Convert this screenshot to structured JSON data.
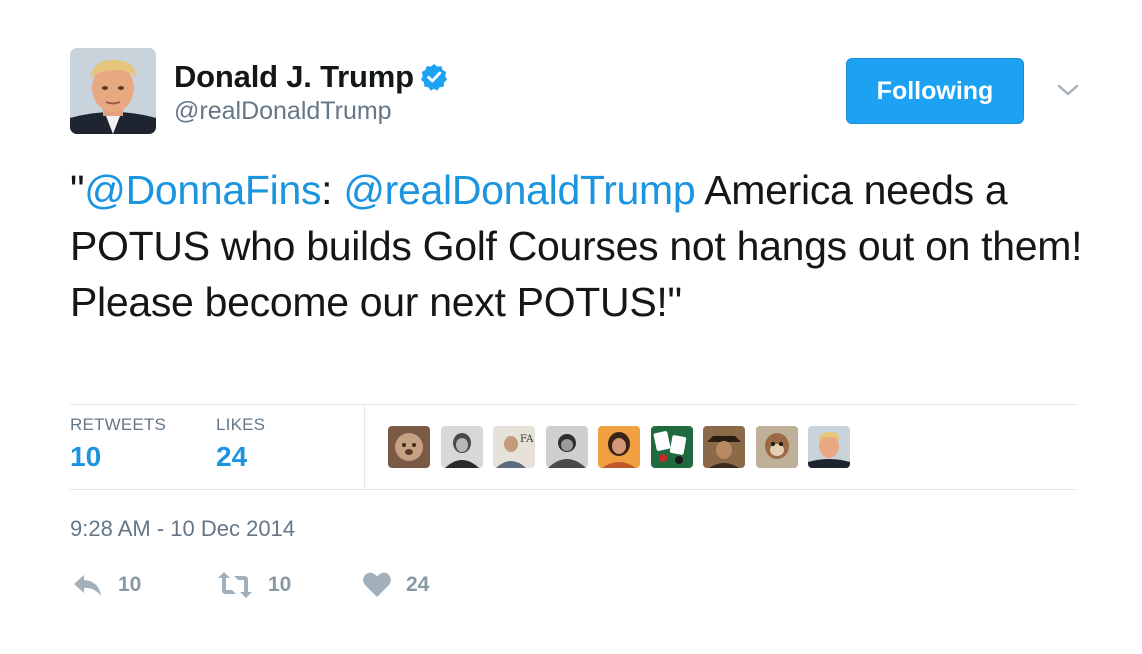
{
  "header": {
    "display_name": "Donald J. Trump",
    "handle": "@realDonaldTrump",
    "verified_icon": "verified-badge-icon",
    "follow_label": "Following",
    "menu_icon": "chevron-down-icon"
  },
  "tweet": {
    "quote_open": "\"",
    "mention_1": "@DonnaFins",
    "colon": ": ",
    "mention_2": "@realDonaldTrump",
    "body": " America needs a POTUS who builds Golf Courses not hangs out on them! Please become our next POTUS!\""
  },
  "stats": {
    "retweets_label": "RETWEETS",
    "retweets_value": "10",
    "likes_label": "LIKES",
    "likes_value": "24"
  },
  "timestamp": "9:28 AM - 10 Dec 2014",
  "actions": {
    "reply_count": "10",
    "retweet_count": "10",
    "like_count": "24"
  },
  "colors": {
    "accent": "#1da1f2",
    "link": "#1b95e0",
    "muted": "#657786"
  }
}
